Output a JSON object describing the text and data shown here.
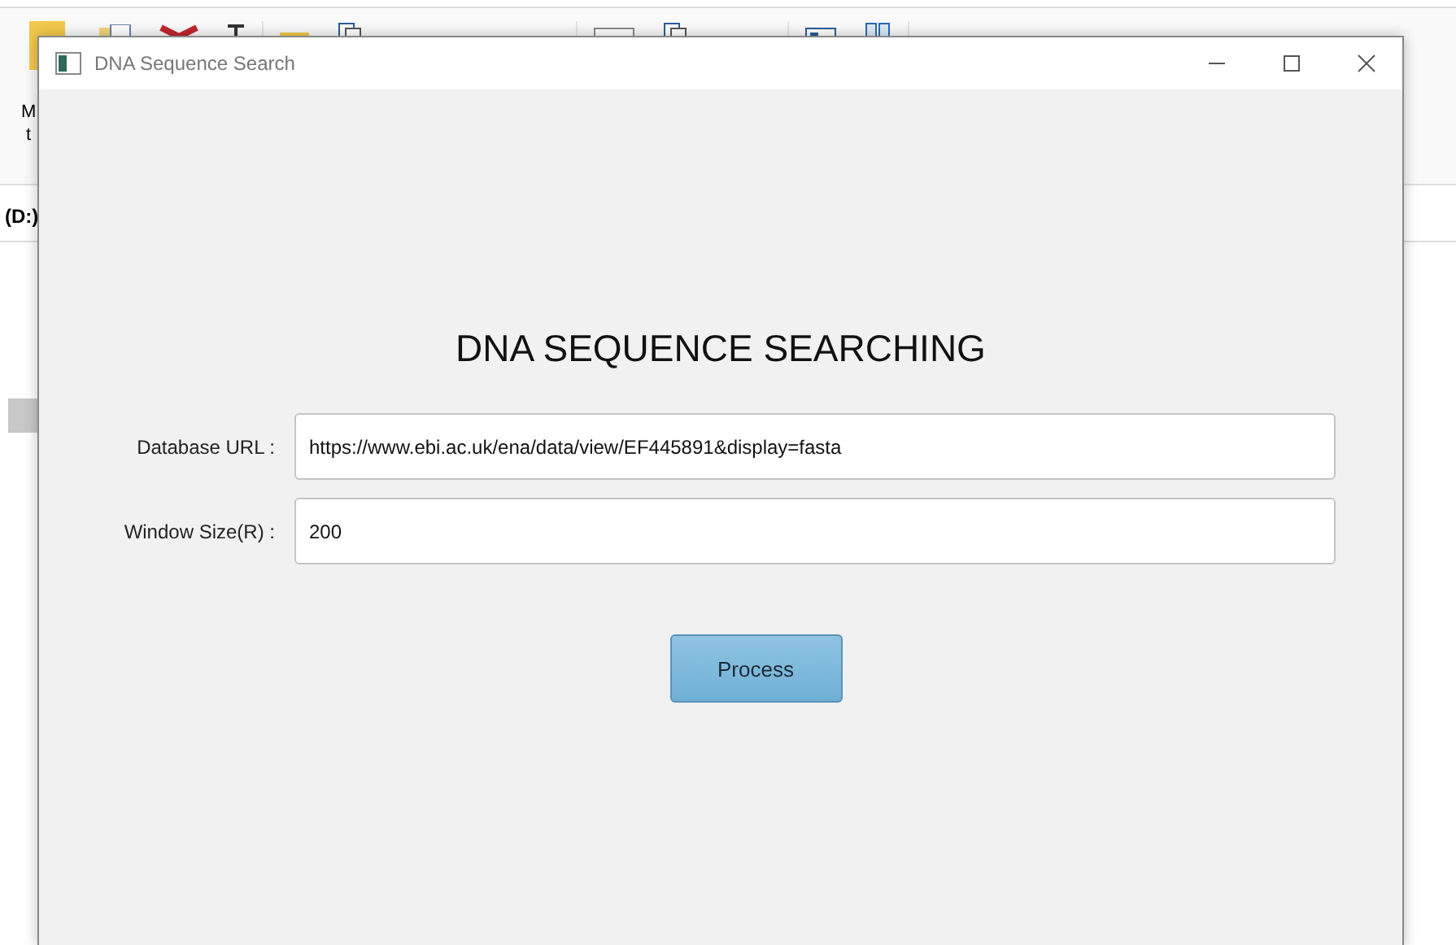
{
  "explorer": {
    "move_button": {
      "lines": [
        "M",
        "t"
      ]
    },
    "location": "(D:)"
  },
  "window": {
    "title": "DNA Sequence Search",
    "heading": "DNA SEQUENCE SEARCHING",
    "fields": [
      {
        "label": "Database URL :",
        "value": "https://www.ebi.ac.uk/ena/data/view/EF445891&display=fasta"
      },
      {
        "label": "Window Size(R) :",
        "value": "200"
      }
    ],
    "button": "Process"
  }
}
